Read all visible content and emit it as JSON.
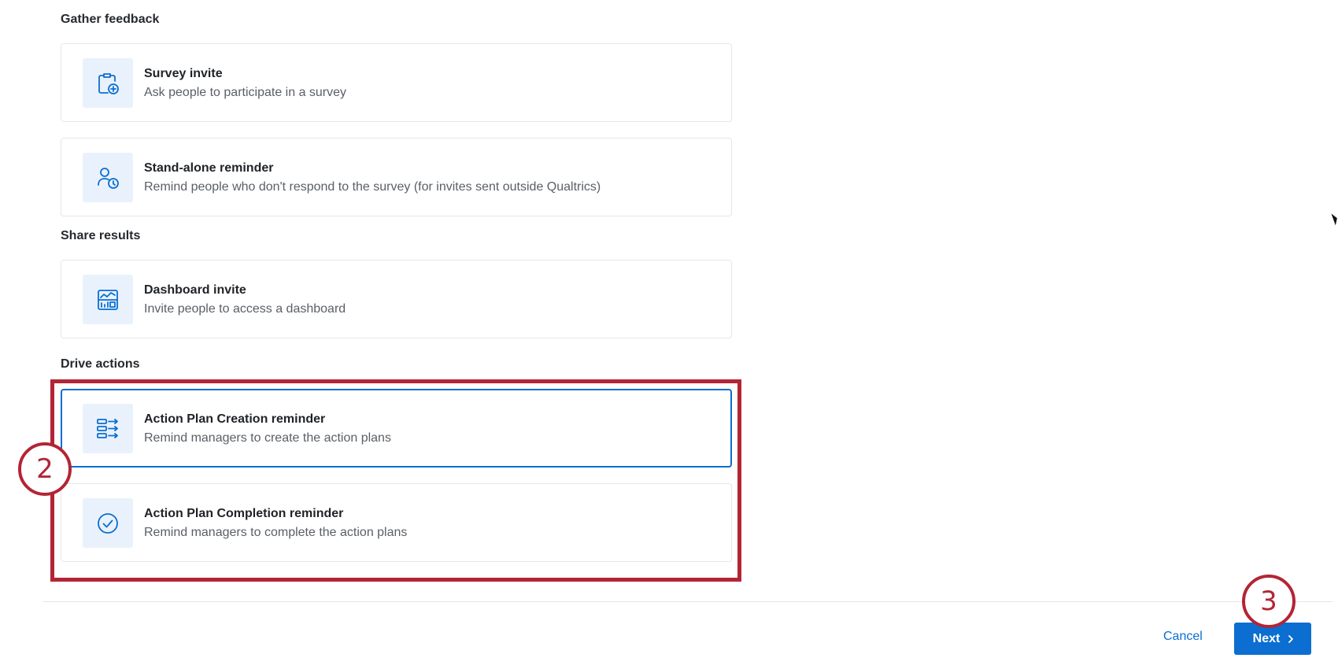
{
  "sections": {
    "gather_feedback": "Gather feedback",
    "share_results": "Share results",
    "drive_actions": "Drive actions"
  },
  "options": {
    "survey_invite": {
      "title": "Survey invite",
      "description": "Ask people to participate in a survey",
      "icon": "clipboard-plus-icon"
    },
    "standalone_reminder": {
      "title": "Stand-alone reminder",
      "description": "Remind people who don't respond to the survey (for invites sent outside Qualtrics)",
      "icon": "person-clock-icon"
    },
    "dashboard_invite": {
      "title": "Dashboard invite",
      "description": "Invite people to access a dashboard",
      "icon": "dashboard-icon"
    },
    "action_plan_creation": {
      "title": "Action Plan Creation reminder",
      "description": "Remind managers to create the action plans",
      "icon": "list-arrows-icon",
      "selected": true
    },
    "action_plan_completion": {
      "title": "Action Plan Completion reminder",
      "description": "Remind managers to complete the action plans",
      "icon": "check-circle-icon"
    }
  },
  "annotations": {
    "step_2": "2",
    "step_3": "3"
  },
  "footer": {
    "cancel_label": "Cancel",
    "next_label": "Next"
  },
  "colors": {
    "accent": "#0b6ed0",
    "icon_bg": "#e9f2fc",
    "annotation_red": "#b32535"
  }
}
